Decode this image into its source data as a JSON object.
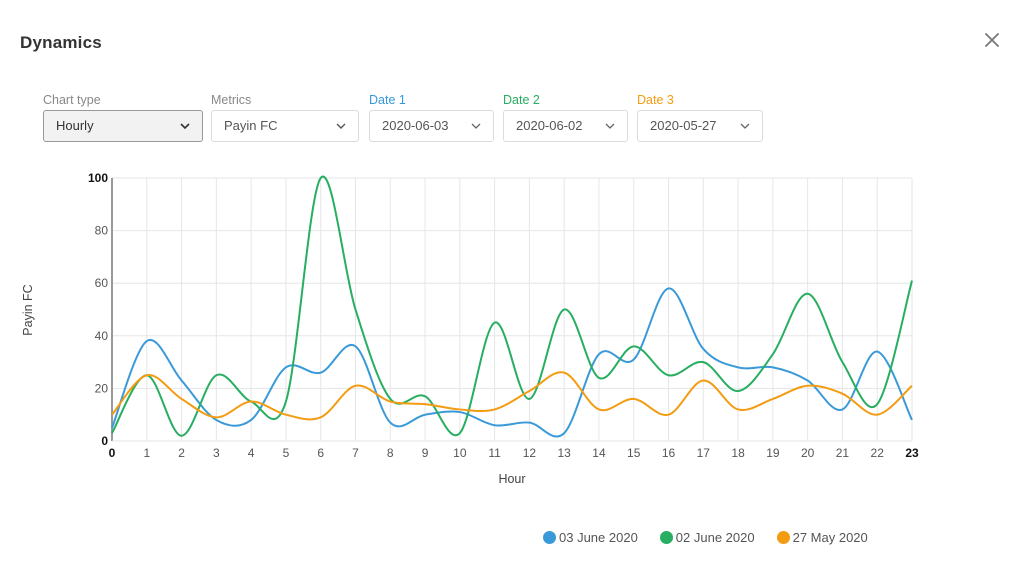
{
  "dialog": {
    "title": "Dynamics",
    "close_icon": "close-icon"
  },
  "controls": {
    "chart_type": {
      "label": "Chart type",
      "value": "Hourly",
      "label_color": "#888888"
    },
    "metrics": {
      "label": "Metrics",
      "value": "Payin FC",
      "label_color": "#888888"
    },
    "date1": {
      "label": "Date 1",
      "value": "2020-06-03",
      "label_color": "#3498db"
    },
    "date2": {
      "label": "Date 2",
      "value": "2020-06-02",
      "label_color": "#27ae60"
    },
    "date3": {
      "label": "Date 3",
      "value": "2020-05-27",
      "label_color": "#f39c12"
    }
  },
  "chart_data": {
    "type": "line",
    "title": "",
    "xlabel": "Hour",
    "ylabel": "Payin FC",
    "x": [
      0,
      1,
      2,
      3,
      4,
      5,
      6,
      7,
      8,
      9,
      10,
      11,
      12,
      13,
      14,
      15,
      16,
      17,
      18,
      19,
      20,
      21,
      22,
      23
    ],
    "xlim": [
      0,
      23
    ],
    "ylim": [
      0,
      100
    ],
    "yticks": [
      0,
      20,
      40,
      60,
      80,
      100
    ],
    "grid": true,
    "legend_position": "bottom-right",
    "series": [
      {
        "name": "03 June 2020",
        "color": "#3a9ad9",
        "values": [
          5,
          38,
          23,
          8,
          8,
          28,
          26,
          36,
          7,
          10,
          11,
          6,
          7,
          3,
          33,
          31,
          58,
          35,
          28,
          28,
          23,
          12,
          34,
          8
        ]
      },
      {
        "name": "02 June 2020",
        "color": "#27ae60",
        "values": [
          3,
          25,
          2,
          25,
          15,
          15,
          100,
          50,
          16,
          17,
          3,
          45,
          16,
          50,
          24,
          36,
          25,
          30,
          19,
          33,
          56,
          30,
          14,
          61
        ]
      },
      {
        "name": "27 May 2020",
        "color": "#f39c12",
        "values": [
          10,
          25,
          16,
          9,
          15,
          10,
          9,
          21,
          15,
          14,
          12,
          12,
          19,
          26,
          12,
          16,
          10,
          23,
          12,
          16,
          21,
          18,
          10,
          21
        ]
      }
    ]
  }
}
